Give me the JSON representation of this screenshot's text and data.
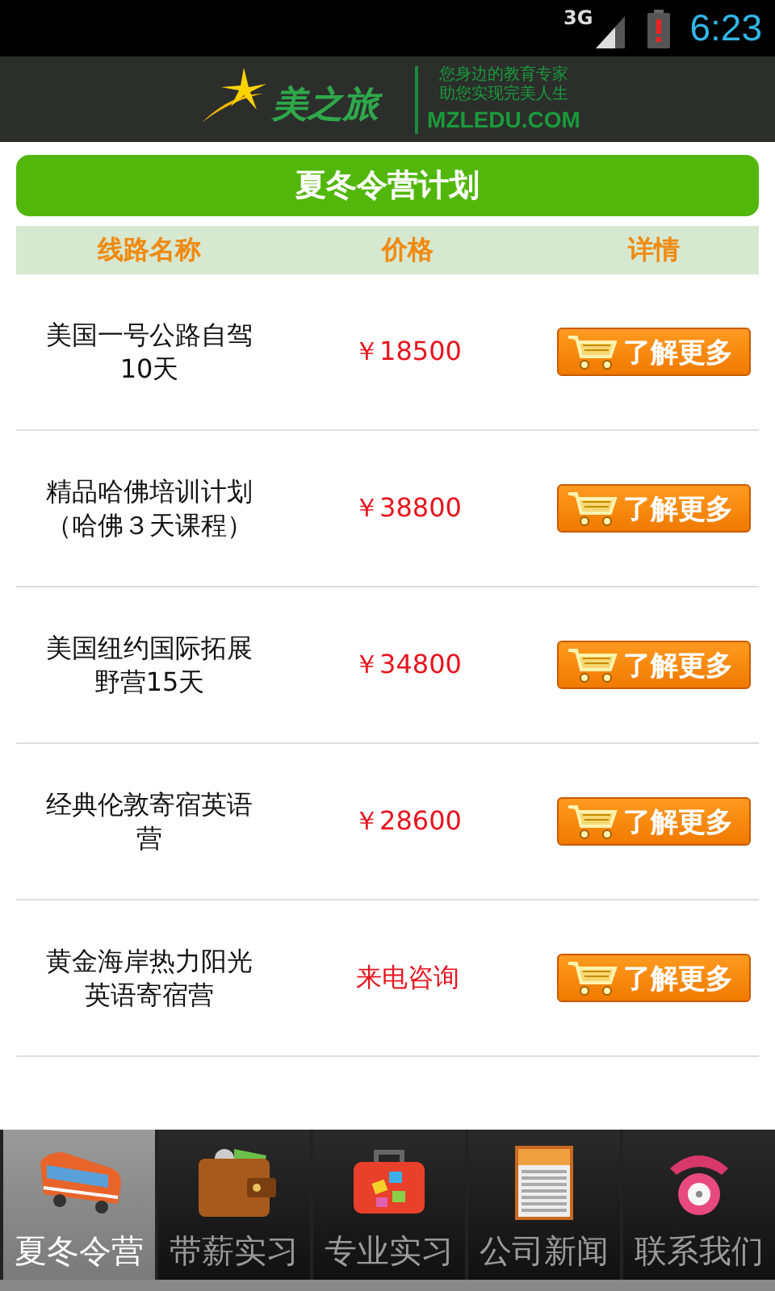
{
  "status_bar": {
    "network": "3G",
    "time": "6:23"
  },
  "header": {
    "logo_text": "美之旅",
    "tagline_lines": [
      "您身边的教育专家",
      "助您实现完美人生"
    ],
    "site": "MZLEDU.COM"
  },
  "title": "夏冬令营计划",
  "table": {
    "columns": [
      "线路名称",
      "价格",
      "详情"
    ],
    "rows": [
      {
        "name": "美国一号公路自驾10天",
        "price": "￥18500",
        "button": "了解更多"
      },
      {
        "name": "精品哈佛培训计划（哈佛３天课程）",
        "price": "￥38800",
        "button": "了解更多"
      },
      {
        "name": "美国纽约国际拓展野营15天",
        "price": "￥34800",
        "button": "了解更多"
      },
      {
        "name": "经典伦敦寄宿英语营",
        "price": "￥28600",
        "button": "了解更多"
      },
      {
        "name": "黄金海岸热力阳光英语寄宿营",
        "price": "来电咨询",
        "button": "了解更多"
      }
    ]
  },
  "tabs": [
    {
      "label": "夏冬令营",
      "kind": "bus",
      "selected": true
    },
    {
      "label": "带薪实习",
      "kind": "wallet",
      "selected": false
    },
    {
      "label": "专业实习",
      "kind": "suitcase",
      "selected": false
    },
    {
      "label": "公司新闻",
      "kind": "newspaper",
      "selected": false
    },
    {
      "label": "联系我们",
      "kind": "phone",
      "selected": false
    }
  ]
}
